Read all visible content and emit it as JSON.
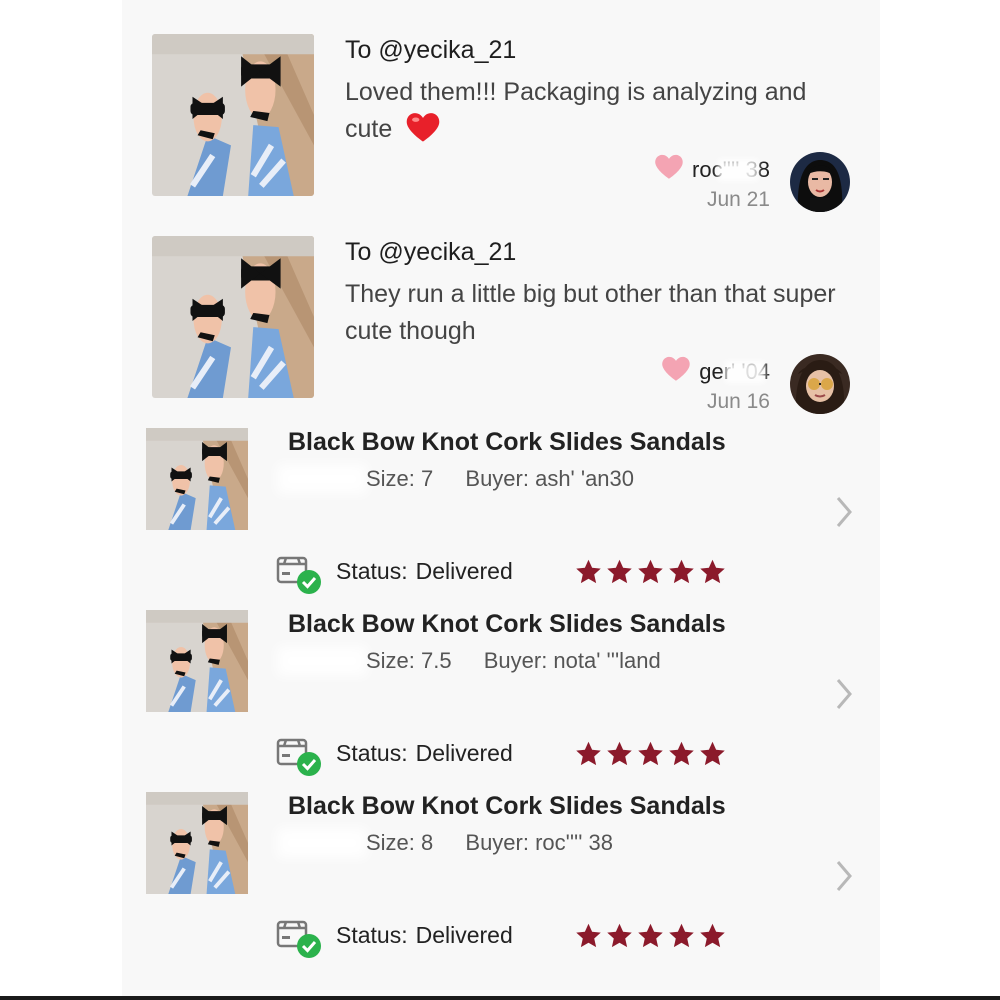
{
  "colors": {
    "star": "#8b1a2b",
    "heart_like": "#f4a4b3",
    "check_badge": "#2bb24c",
    "chevron": "#b8b8b8"
  },
  "reviews": [
    {
      "to": "To @yecika_21",
      "text": "Loved them!!! Packaging is analyzing and cute",
      "emoji": "red-heart",
      "liked_by": "roc'''' 38",
      "date": "Jun 21"
    },
    {
      "to": "To @yecika_21",
      "text": "They run a little big but other than that super cute though",
      "liked_by": "ger' '04",
      "date": "Jun 16"
    }
  ],
  "orders": [
    {
      "title": "Black Bow Knot Cork Slides Sandals",
      "size": "Size: 7",
      "buyer": "Buyer: ash' 'an30",
      "status_label": "Status:",
      "status_value": "Delivered",
      "rating": 5
    },
    {
      "title": "Black Bow Knot Cork Slides Sandals",
      "size": "Size: 7.5",
      "buyer": "Buyer: nota' '''land",
      "status_label": "Status:",
      "status_value": "Delivered",
      "rating": 5
    },
    {
      "title": "Black Bow Knot Cork Slides Sandals",
      "size": "Size: 8",
      "buyer": "Buyer: roc'''' 38",
      "status_label": "Status:",
      "status_value": "Delivered",
      "rating": 5
    }
  ]
}
